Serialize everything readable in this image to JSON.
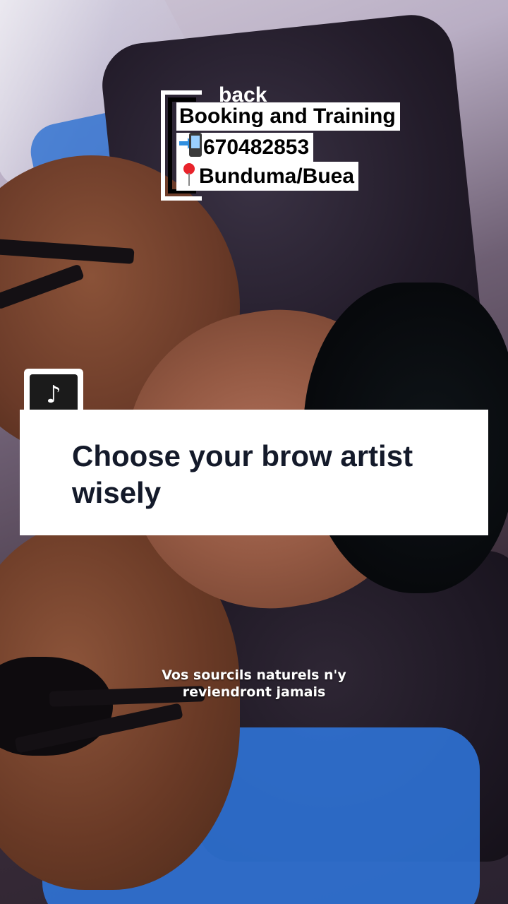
{
  "overlay": {
    "back_label": "back",
    "booking_title": "Booking and Training",
    "phone_number": "670482853",
    "location": "Bunduma/Buea",
    "phone_icon": "mobile-phone-arrow-icon",
    "location_icon": "round-pushpin-icon"
  },
  "tiktok": {
    "logo_icon": "tiktok-logo-icon",
    "logo_glyph": "♪"
  },
  "caption": {
    "text": "Choose your brow artist wisely"
  },
  "subtitle": {
    "line1": "Vos sourcils naturels n'y",
    "line2": "reviendront jamais"
  },
  "colors": {
    "caption_text": "#141a2a",
    "overlay_bg": "#ffffff",
    "tiktok_tile": "#1b1b1b"
  }
}
